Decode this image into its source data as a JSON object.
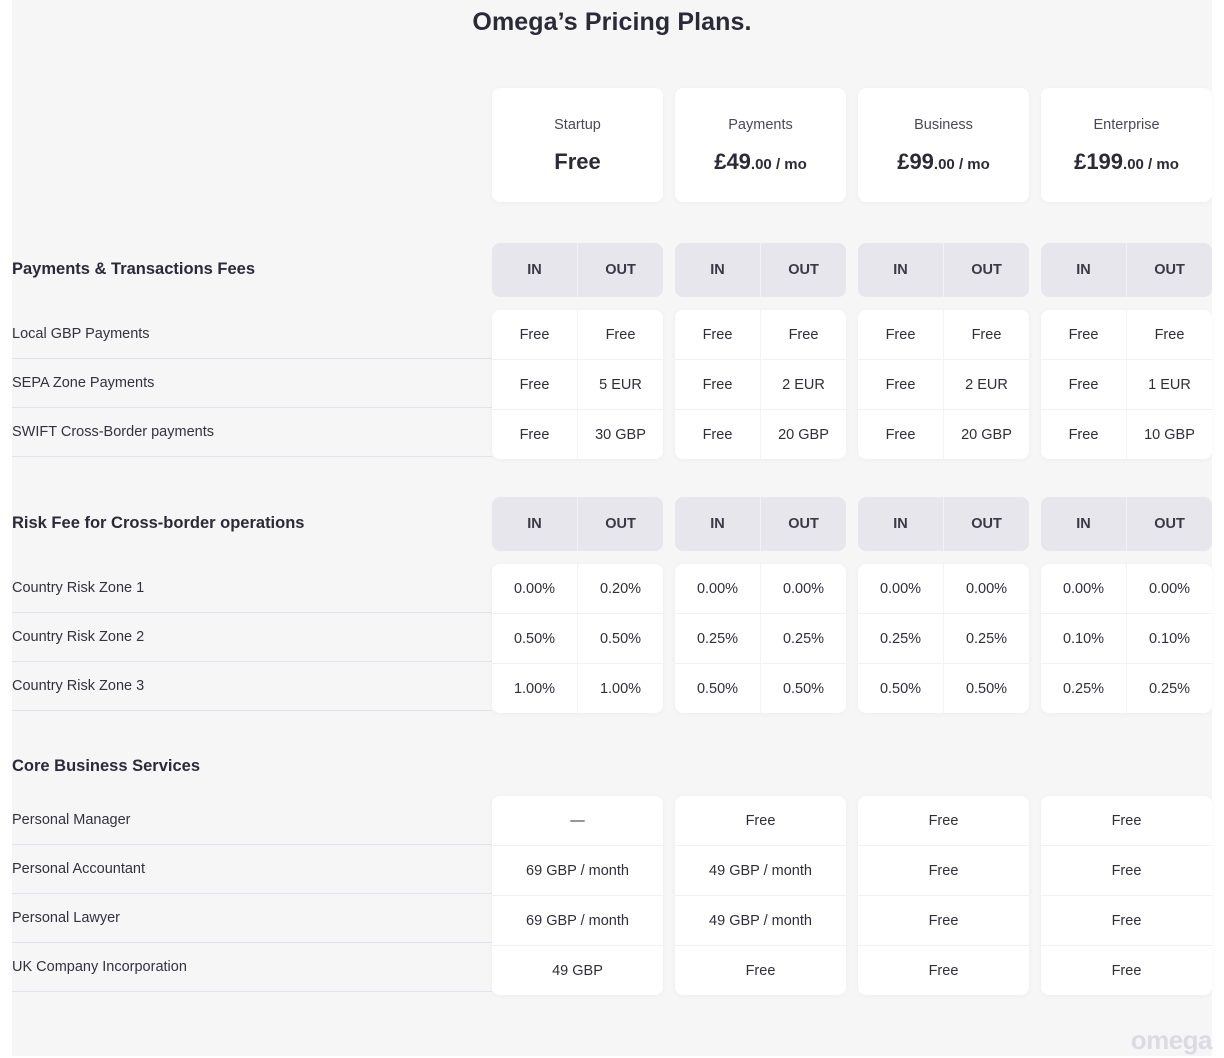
{
  "page": {
    "title": "Omega’s Pricing Plans.",
    "logo_text": "omega"
  },
  "plans": [
    {
      "name": "Startup",
      "price_main": "Free",
      "price_cents": "",
      "price_period": ""
    },
    {
      "name": "Payments",
      "price_main": "£49",
      "price_cents": ".00",
      "price_period": " / mo"
    },
    {
      "name": "Business",
      "price_main": "£99",
      "price_cents": ".00",
      "price_period": " / mo"
    },
    {
      "name": "Enterprise",
      "price_main": "£199",
      "price_cents": ".00",
      "price_period": " / mo"
    }
  ],
  "io_labels": {
    "in": "IN",
    "out": "OUT"
  },
  "sections": {
    "payments": {
      "title": "Payments & Transactions Fees",
      "rows": [
        {
          "label": "Local GBP Payments",
          "values": [
            [
              "Free",
              "Free"
            ],
            [
              "Free",
              "Free"
            ],
            [
              "Free",
              "Free"
            ],
            [
              "Free",
              "Free"
            ]
          ]
        },
        {
          "label": "SEPA Zone Payments",
          "values": [
            [
              "Free",
              "5 EUR"
            ],
            [
              "Free",
              "2 EUR"
            ],
            [
              "Free",
              "2 EUR"
            ],
            [
              "Free",
              "1 EUR"
            ]
          ]
        },
        {
          "label": "SWIFT Cross-Border payments",
          "values": [
            [
              "Free",
              "30 GBP"
            ],
            [
              "Free",
              "20 GBP"
            ],
            [
              "Free",
              "20 GBP"
            ],
            [
              "Free",
              "10 GBP"
            ]
          ]
        }
      ]
    },
    "risk": {
      "title": "Risk Fee for Cross-border operations",
      "rows": [
        {
          "label": "Country Risk Zone 1",
          "values": [
            [
              "0.00%",
              "0.20%"
            ],
            [
              "0.00%",
              "0.00%"
            ],
            [
              "0.00%",
              "0.00%"
            ],
            [
              "0.00%",
              "0.00%"
            ]
          ]
        },
        {
          "label": "Country Risk Zone 2",
          "values": [
            [
              "0.50%",
              "0.50%"
            ],
            [
              "0.25%",
              "0.25%"
            ],
            [
              "0.25%",
              "0.25%"
            ],
            [
              "0.10%",
              "0.10%"
            ]
          ]
        },
        {
          "label": "Country Risk Zone 3",
          "values": [
            [
              "1.00%",
              "1.00%"
            ],
            [
              "0.50%",
              "0.50%"
            ],
            [
              "0.50%",
              "0.50%"
            ],
            [
              "0.25%",
              "0.25%"
            ]
          ]
        }
      ]
    },
    "core": {
      "title": "Core Business Services",
      "rows": [
        {
          "label": "Personal Manager",
          "values": [
            "—",
            "Free",
            "Free",
            "Free"
          ]
        },
        {
          "label": "Personal Accountant",
          "values": [
            "69 GBP / month",
            "49 GBP / month",
            "Free",
            "Free"
          ]
        },
        {
          "label": "Personal Lawyer",
          "values": [
            "69 GBP / month",
            "49 GBP / month",
            "Free",
            "Free"
          ]
        },
        {
          "label": "UK Company Incorporation",
          "values": [
            "49 GBP",
            "Free",
            "Free",
            "Free"
          ]
        }
      ]
    }
  }
}
